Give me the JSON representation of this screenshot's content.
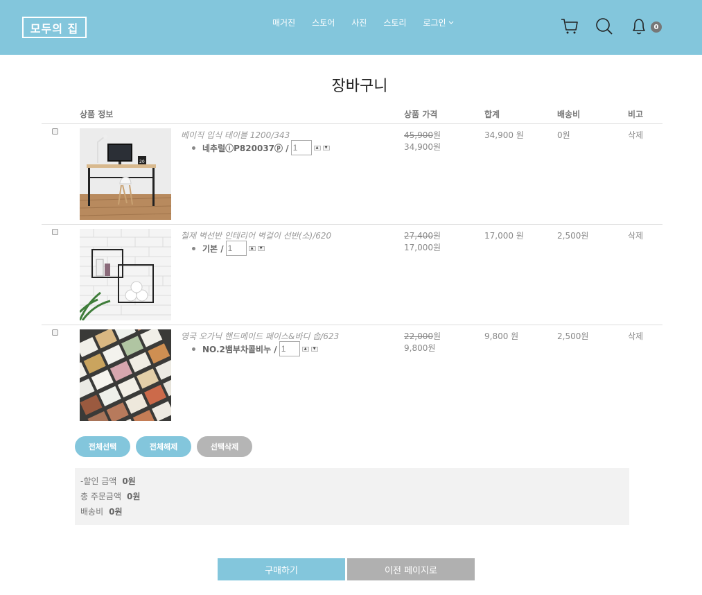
{
  "header": {
    "logo": "모두의 집",
    "nav": [
      "매거진",
      "스토어",
      "사진",
      "스토리",
      "로그인"
    ],
    "icons": [
      "cart-icon",
      "search-icon",
      "bell-icon"
    ],
    "notification_count": "0",
    "bg_color": "#83c6dc"
  },
  "page": {
    "title": "장바구니"
  },
  "table": {
    "headers": {
      "info": "상품 정보",
      "price": "상품 가격",
      "total": "합계",
      "shipping": "배송비",
      "note": "비고"
    },
    "rows": [
      {
        "name": "베이직 입식 테이블 1200/343",
        "option": "네추럴ⓘP820037ⓟ /",
        "qty": "1",
        "orig_price": "45,900",
        "orig_unit": "원",
        "sale_price": "34,900원",
        "sum": "34,900 원",
        "shipping": "0원",
        "delete": "삭제"
      },
      {
        "name": "철제 벽선반 인테리어 벽걸이 선반(소)/620",
        "option": "기본 /",
        "qty": "1",
        "orig_price": "27,400",
        "orig_unit": "원",
        "sale_price": "17,000원",
        "sum": "17,000 원",
        "shipping": "2,500원",
        "delete": "삭제"
      },
      {
        "name": "영국 오가닉 핸드메이드 페이스&바디 솝/623",
        "option": "NO.2뱀부차콜비누 /",
        "qty": "1",
        "orig_price": "22,000",
        "orig_unit": "원",
        "sale_price": "9,800원",
        "sum": "9,800 원",
        "shipping": "2,500원",
        "delete": "삭제"
      }
    ]
  },
  "actions": {
    "select_all": "전체선택",
    "deselect_all": "전체해제",
    "delete_selected": "선택삭제"
  },
  "summary": {
    "discount_label": "-할인 금액",
    "discount_value": "0원",
    "order_label": "총 주문금액",
    "order_value": "0원",
    "shipping_label": "배송비",
    "shipping_value": "0원"
  },
  "footer_buttons": {
    "buy": "구매하기",
    "back": "이전 페이지로"
  }
}
